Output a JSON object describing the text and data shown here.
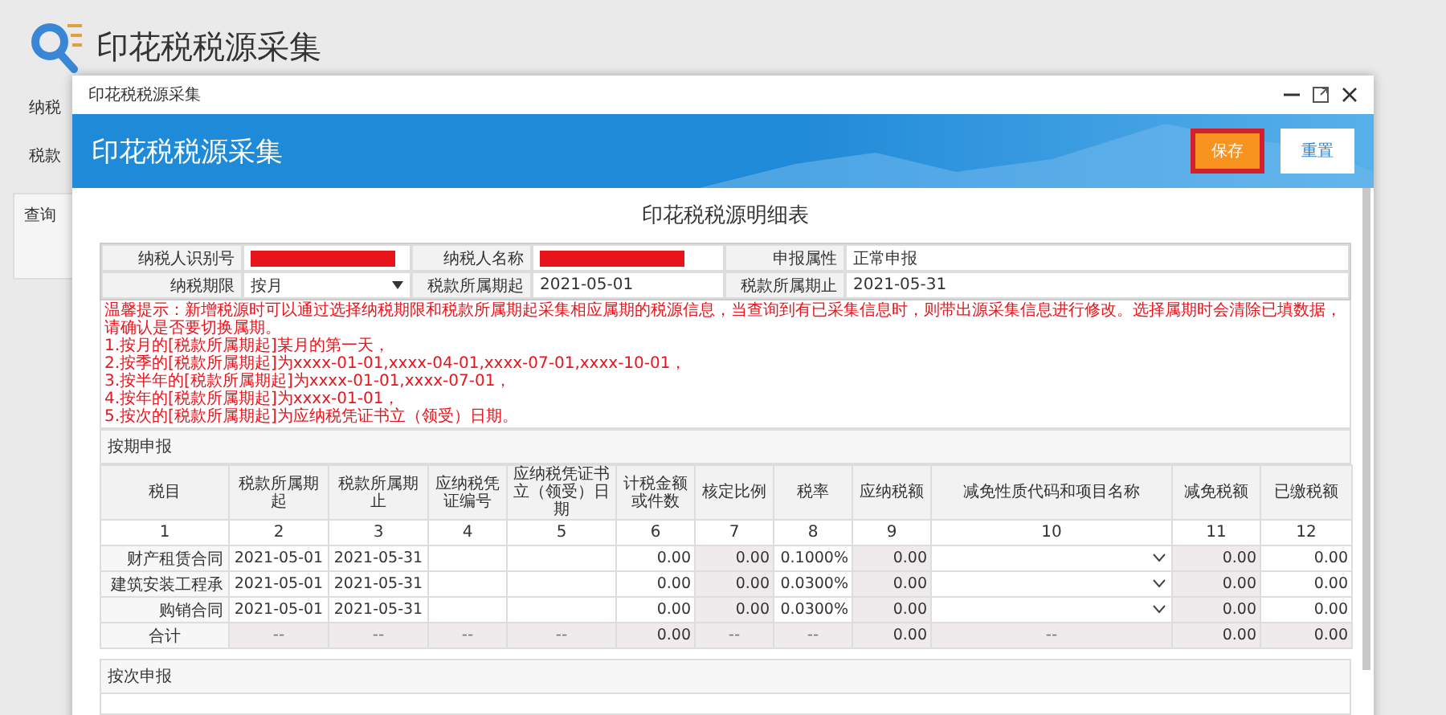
{
  "page": {
    "title": "印花税税源采集",
    "labels": [
      "纳税",
      "税款"
    ],
    "query_label": "查询"
  },
  "dialog": {
    "title": "印花税税源采集",
    "banner_title": "印花税税源采集",
    "buttons": [
      {
        "label": "保存",
        "kind": "primary",
        "highlighted": true
      },
      {
        "label": "重置",
        "kind": "secondary",
        "highlighted": false
      }
    ]
  },
  "form_title": "印花税税源明细表",
  "info": [
    {
      "label": "纳税人识别号",
      "kind": "redacted"
    },
    {
      "label": "纳税人名称",
      "kind": "redacted"
    },
    {
      "label": "申报属性",
      "kind": "text",
      "value": "正常申报"
    },
    {
      "label": "纳税期限",
      "kind": "select",
      "value": "按月"
    },
    {
      "label": "税款所属期起",
      "kind": "text",
      "value": "2021-05-01"
    },
    {
      "label": "税款所属期止",
      "kind": "text",
      "value": "2021-05-31"
    }
  ],
  "notice": [
    "温馨提示：新增税源时可以通过选择纳税期限和税款所属期起采集相应属期的税源信息，当查询到有已采集信息时，则带出源采集信息进行修改。选择属期时会清除已填数据，请确认是否要切换属期。",
    "1.按月的[税款所属期起]某月的第一天，",
    "2.按季的[税款所属期起]为xxxx-01-01,xxxx-04-01,xxxx-07-01,xxxx-10-01，",
    "3.按半年的[税款所属期起]为xxxx-01-01,xxxx-07-01，",
    "4.按年的[税款所属期起]为xxxx-01-01，",
    "5.按次的[税款所属期起]为应纳税凭证书立（领受）日期。"
  ],
  "periodic": {
    "title": "按期申报",
    "columns": [
      {
        "label": "税目",
        "number": "1"
      },
      {
        "label": "税款所属期起",
        "number": "2"
      },
      {
        "label": "税款所属期止",
        "number": "3"
      },
      {
        "label": "应纳税凭证编号",
        "number": "4"
      },
      {
        "label": "应纳税凭证书立（领受）日期",
        "number": "5"
      },
      {
        "label": "计税金额或件数",
        "number": "6"
      },
      {
        "label": "核定比例",
        "number": "7"
      },
      {
        "label": "税率",
        "number": "8"
      },
      {
        "label": "应纳税额",
        "number": "9"
      },
      {
        "label": "减免性质代码和项目名称",
        "number": "10"
      },
      {
        "label": "减免税额",
        "number": "11"
      },
      {
        "label": "已缴税额",
        "number": "12"
      }
    ],
    "rows": [
      [
        {
          "kind": "label",
          "text": "财产租赁合同"
        },
        {
          "kind": "text",
          "text": "2021-05-01"
        },
        {
          "kind": "text",
          "text": "2021-05-31"
        },
        {
          "kind": "empty"
        },
        {
          "kind": "empty"
        },
        {
          "kind": "number",
          "text": "0.00"
        },
        {
          "kind": "readonly",
          "text": "0.00"
        },
        {
          "kind": "number",
          "text": "0.1000%"
        },
        {
          "kind": "readonly",
          "text": "0.00"
        },
        {
          "kind": "select"
        },
        {
          "kind": "readonly",
          "text": "0.00"
        },
        {
          "kind": "number",
          "text": "0.00"
        }
      ],
      [
        {
          "kind": "label",
          "text": "建筑安装工程承"
        },
        {
          "kind": "text",
          "text": "2021-05-01"
        },
        {
          "kind": "text",
          "text": "2021-05-31"
        },
        {
          "kind": "empty"
        },
        {
          "kind": "empty"
        },
        {
          "kind": "number",
          "text": "0.00"
        },
        {
          "kind": "readonly",
          "text": "0.00"
        },
        {
          "kind": "number",
          "text": "0.0300%"
        },
        {
          "kind": "readonly",
          "text": "0.00"
        },
        {
          "kind": "select"
        },
        {
          "kind": "readonly",
          "text": "0.00"
        },
        {
          "kind": "number",
          "text": "0.00"
        }
      ],
      [
        {
          "kind": "label",
          "text": "购销合同"
        },
        {
          "kind": "text",
          "text": "2021-05-01"
        },
        {
          "kind": "text",
          "text": "2021-05-31"
        },
        {
          "kind": "empty"
        },
        {
          "kind": "empty"
        },
        {
          "kind": "number",
          "text": "0.00"
        },
        {
          "kind": "readonly",
          "text": "0.00"
        },
        {
          "kind": "number",
          "text": "0.0300%"
        },
        {
          "kind": "readonly",
          "text": "0.00"
        },
        {
          "kind": "select"
        },
        {
          "kind": "readonly",
          "text": "0.00"
        },
        {
          "kind": "number",
          "text": "0.00"
        }
      ],
      [
        {
          "kind": "total",
          "text": "合计"
        },
        {
          "kind": "dash",
          "text": "--"
        },
        {
          "kind": "dash",
          "text": "--"
        },
        {
          "kind": "dash",
          "text": "--"
        },
        {
          "kind": "dash",
          "text": "--"
        },
        {
          "kind": "readonly",
          "text": "0.00"
        },
        {
          "kind": "dash",
          "text": "--"
        },
        {
          "kind": "dash",
          "text": "--"
        },
        {
          "kind": "readonly",
          "text": "0.00"
        },
        {
          "kind": "dash",
          "text": "--"
        },
        {
          "kind": "readonly",
          "text": "0.00"
        },
        {
          "kind": "readonly",
          "text": "0.00"
        }
      ]
    ]
  },
  "per_time": {
    "title": "按次申报"
  }
}
